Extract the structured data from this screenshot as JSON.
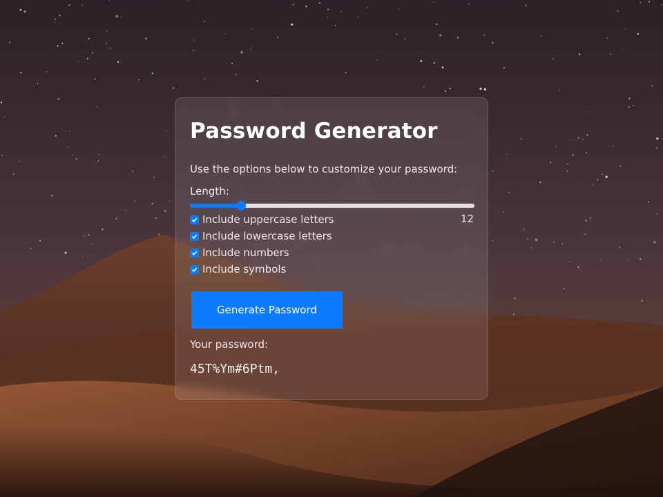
{
  "card": {
    "title": "Password Generator",
    "subtitle": "Use the options below to customize your password:",
    "length_label": "Length:",
    "length_value": "12",
    "slider_fraction": 0.18,
    "options": [
      {
        "label": "Include uppercase letters",
        "checked": true
      },
      {
        "label": "Include lowercase letters",
        "checked": true
      },
      {
        "label": "Include numbers",
        "checked": true
      },
      {
        "label": "Include symbols",
        "checked": true
      }
    ],
    "generate_label": "Generate Password",
    "password_label": "Your password:",
    "password_value": "45T%Ym#6Ptm,"
  },
  "colors": {
    "accent": "#0d7bff",
    "card_bg": "rgba(255,255,255,0.10)",
    "text": "#ffffff"
  }
}
